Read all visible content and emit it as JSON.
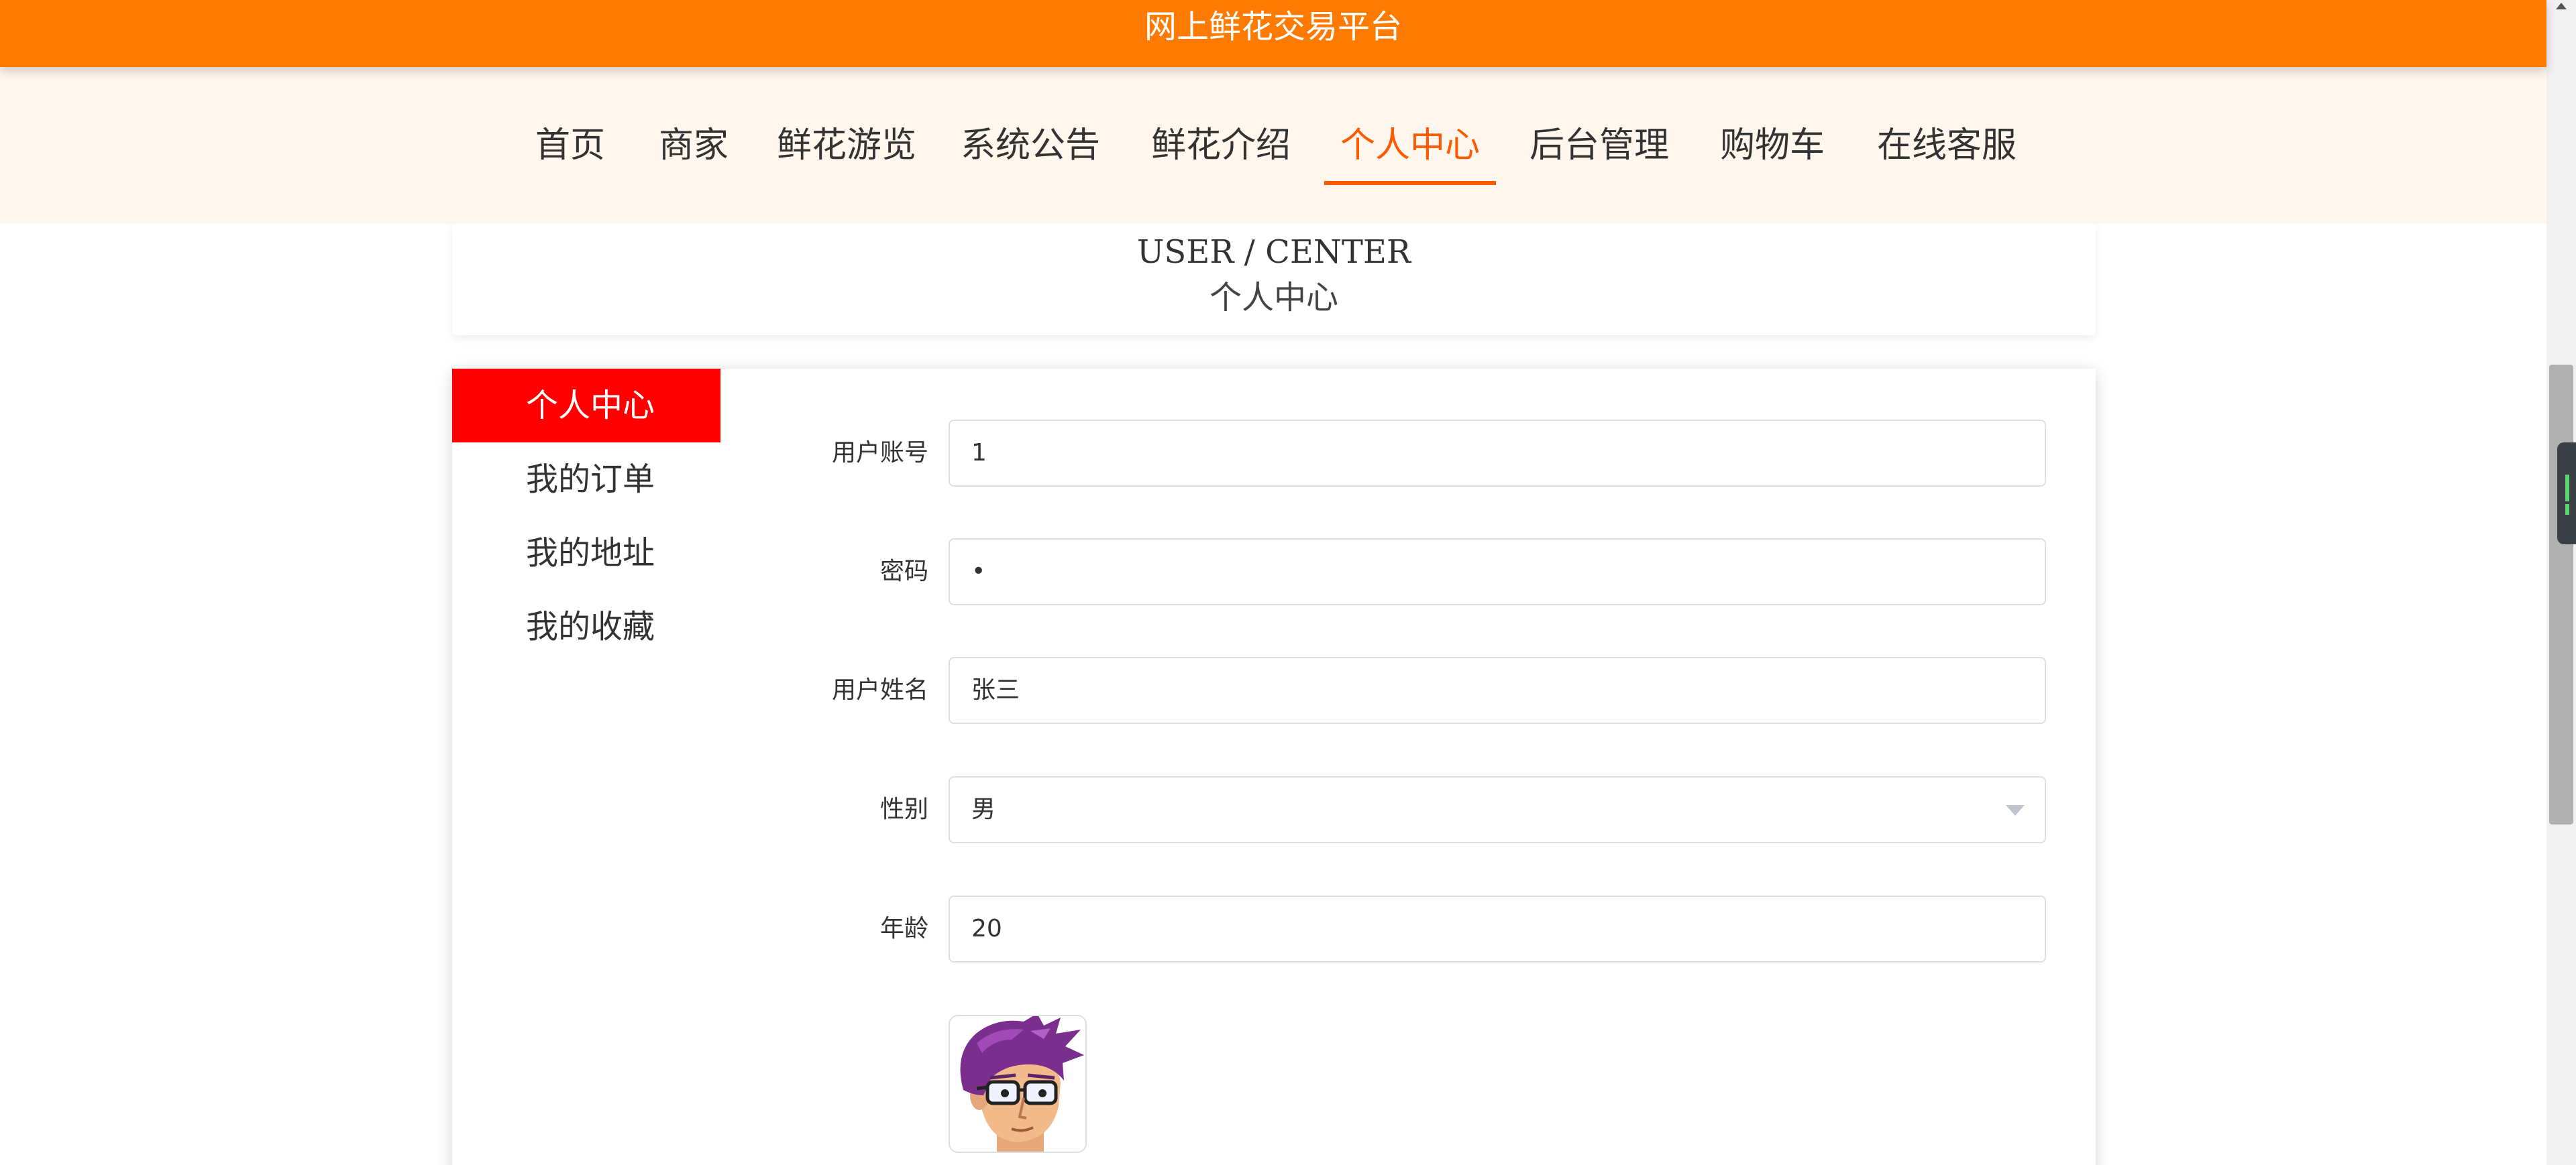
{
  "site": {
    "title": "网上鲜花交易平台"
  },
  "nav": {
    "items": [
      {
        "label": "首页"
      },
      {
        "label": "商家"
      },
      {
        "label": "鲜花游览"
      },
      {
        "label": "系统公告"
      },
      {
        "label": "鲜花介绍"
      },
      {
        "label": "个人中心",
        "active": true
      },
      {
        "label": "后台管理"
      },
      {
        "label": "购物车"
      },
      {
        "label": "在线客服"
      }
    ]
  },
  "page_header": {
    "title_en": "USER / CENTER",
    "title_cn": "个人中心"
  },
  "side_menu": {
    "items": [
      {
        "label": "个人中心",
        "active": true
      },
      {
        "label": "我的订单"
      },
      {
        "label": "我的地址"
      },
      {
        "label": "我的收藏"
      }
    ]
  },
  "form": {
    "account": {
      "label": "用户账号",
      "value": "1"
    },
    "password": {
      "label": "密码",
      "value": "•"
    },
    "name": {
      "label": "用户姓名",
      "value": "张三"
    },
    "gender": {
      "label": "性别",
      "value": "男"
    },
    "age": {
      "label": "年龄",
      "value": "20"
    }
  },
  "avatar": {
    "icon": "avatar-cartoon-man-glasses-icon"
  },
  "colors": {
    "title_bar": "#ff7a00",
    "nav_background": "#fff6ee",
    "nav_active": "#ff5a00",
    "side_active": "#ff0000"
  }
}
